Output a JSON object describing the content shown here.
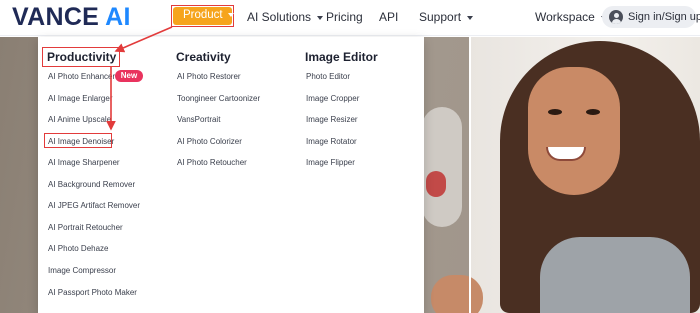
{
  "logo": {
    "part1": "VANCE",
    "part2": "AI"
  },
  "nav": {
    "product": "Product",
    "ai_solutions": "AI Solutions",
    "pricing": "Pricing",
    "api": "API",
    "support": "Support",
    "workspace": "Workspace",
    "signin": "Sign in/Sign up"
  },
  "menu": {
    "columns": [
      {
        "heading": "Productivity",
        "items": [
          "AI Photo Enhancer",
          "AI Image Enlarger",
          "AI Anime Upscale",
          "AI Image Denoiser",
          "AI Image Sharpener",
          "AI Background Remover",
          "AI JPEG Artifact Remover",
          "AI Portrait Retoucher",
          "AI Photo Dehaze",
          "Image Compressor",
          "AI Passport Photo Maker"
        ]
      },
      {
        "heading": "Creativity",
        "items": [
          "AI Photo Restorer",
          "Toongineer Cartoonizer",
          "VansPortrait",
          "AI Photo Colorizer",
          "AI Photo Retoucher"
        ]
      },
      {
        "heading": "Image Editor",
        "items": [
          "Photo Editor",
          "Image Cropper",
          "Image Resizer",
          "Image Rotator",
          "Image Flipper"
        ]
      }
    ],
    "new_badge": "New"
  },
  "colors": {
    "brand_dark": "#1f2a56",
    "brand_blue": "#1e88ff",
    "product_orange": "#f6a41c",
    "annotation_red": "#e23b3b",
    "badge_pink": "#e9335e"
  },
  "icons": {
    "caret": "chevron-down-icon",
    "user": "user-circle-icon"
  }
}
